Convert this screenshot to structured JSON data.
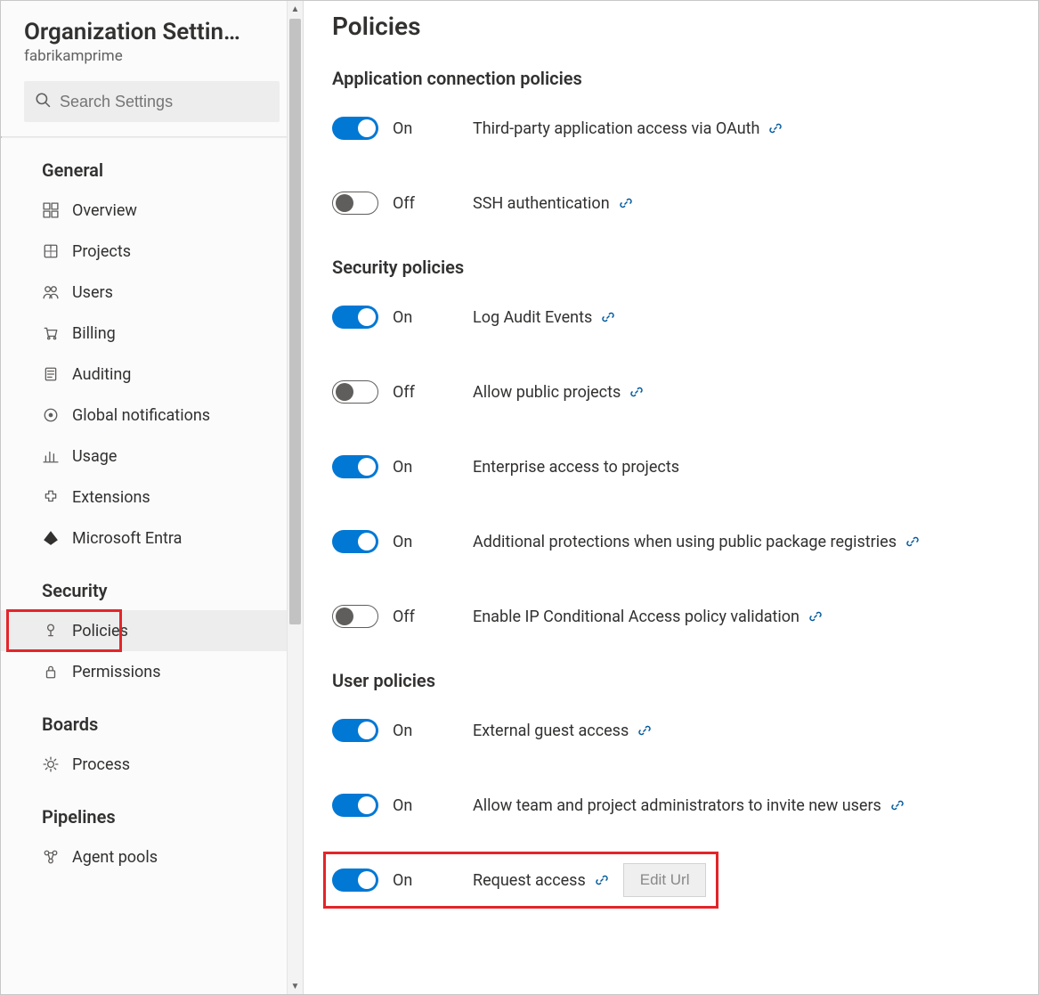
{
  "sidebar": {
    "title": "Organization Settin…",
    "subtitle": "fabrikamprime",
    "search_placeholder": "Search Settings",
    "groups": [
      {
        "label": "General",
        "items": [
          {
            "id": "overview",
            "label": "Overview",
            "icon": "grid-icon"
          },
          {
            "id": "projects",
            "label": "Projects",
            "icon": "projects-icon"
          },
          {
            "id": "users",
            "label": "Users",
            "icon": "users-icon"
          },
          {
            "id": "billing",
            "label": "Billing",
            "icon": "cart-icon"
          },
          {
            "id": "auditing",
            "label": "Auditing",
            "icon": "auditing-icon"
          },
          {
            "id": "global-notifications",
            "label": "Global notifications",
            "icon": "notification-icon"
          },
          {
            "id": "usage",
            "label": "Usage",
            "icon": "usage-icon"
          },
          {
            "id": "extensions",
            "label": "Extensions",
            "icon": "extension-icon"
          },
          {
            "id": "microsoft-entra",
            "label": "Microsoft Entra",
            "icon": "entra-icon"
          }
        ]
      },
      {
        "label": "Security",
        "items": [
          {
            "id": "policies",
            "label": "Policies",
            "icon": "policy-icon",
            "selected": true
          },
          {
            "id": "permissions",
            "label": "Permissions",
            "icon": "lock-icon"
          }
        ]
      },
      {
        "label": "Boards",
        "items": [
          {
            "id": "process",
            "label": "Process",
            "icon": "process-icon"
          }
        ]
      },
      {
        "label": "Pipelines",
        "items": [
          {
            "id": "agent-pools",
            "label": "Agent pools",
            "icon": "agent-pools-icon"
          }
        ]
      }
    ]
  },
  "main": {
    "page_title": "Policies",
    "toggle_labels": {
      "on": "On",
      "off": "Off"
    },
    "edit_url_label": "Edit Url",
    "sections": [
      {
        "title": "Application connection policies",
        "policies": [
          {
            "id": "oauth-access",
            "on": true,
            "label": "Third-party application access via OAuth",
            "link": true
          },
          {
            "id": "ssh-auth",
            "on": false,
            "label": "SSH authentication",
            "link": true
          }
        ]
      },
      {
        "title": "Security policies",
        "policies": [
          {
            "id": "log-audit",
            "on": true,
            "label": "Log Audit Events",
            "link": true
          },
          {
            "id": "public-projects",
            "on": false,
            "label": "Allow public projects",
            "link": true
          },
          {
            "id": "enterprise-access",
            "on": true,
            "label": "Enterprise access to projects",
            "link": false
          },
          {
            "id": "public-pkg-protect",
            "on": true,
            "label": "Additional protections when using public package registries",
            "link": true
          },
          {
            "id": "ip-conditional",
            "on": false,
            "label": "Enable IP Conditional Access policy validation",
            "link": true
          }
        ]
      },
      {
        "title": "User policies",
        "policies": [
          {
            "id": "external-guest",
            "on": true,
            "label": "External guest access",
            "link": true
          },
          {
            "id": "admin-invite",
            "on": true,
            "label": "Allow team and project administrators to invite new users",
            "link": true
          },
          {
            "id": "request-access",
            "on": true,
            "label": "Request access",
            "link": true,
            "edit_url": true
          }
        ]
      }
    ]
  }
}
